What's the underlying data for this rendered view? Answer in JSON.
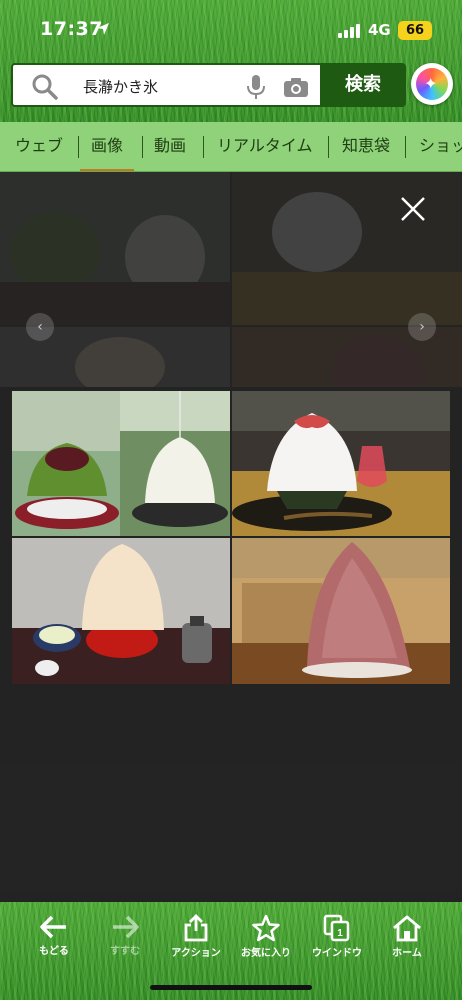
{
  "status_bar": {
    "time": "17:37",
    "network": "4G",
    "battery": "66"
  },
  "search": {
    "query": "長瀞かき氷",
    "search_button_label": "検索"
  },
  "tabs": [
    {
      "label": "ウェブ",
      "active": false
    },
    {
      "label": "画像",
      "active": true
    },
    {
      "label": "動画",
      "active": false
    },
    {
      "label": "リアルタイム",
      "active": false
    },
    {
      "label": "知恵袋",
      "active": false
    },
    {
      "label": "ショッ",
      "active": false
    }
  ],
  "bottom_nav": [
    {
      "label": "もどる",
      "icon": "back-arrow-icon",
      "enabled": true
    },
    {
      "label": "すすむ",
      "icon": "forward-arrow-icon",
      "enabled": false
    },
    {
      "label": "アクション",
      "icon": "share-icon",
      "enabled": true
    },
    {
      "label": "お気に入り",
      "icon": "star-icon",
      "enabled": true
    },
    {
      "label": "ウインドウ",
      "icon": "windows-icon",
      "enabled": true
    },
    {
      "label": "ホーム",
      "icon": "home-icon",
      "enabled": true
    }
  ],
  "colors": {
    "brand_green": "#1f5a12",
    "tab_bar": "#8fd27a",
    "tab_active_underline": "#c07a22",
    "battery": "#f5d21b"
  }
}
